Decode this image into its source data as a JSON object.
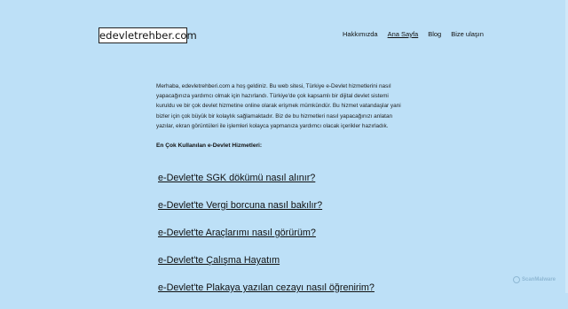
{
  "header": {
    "logo_text": "edevletrehber.com",
    "nav": [
      {
        "label": "Hakkımızda",
        "active": false
      },
      {
        "label": "Ana Sayfa",
        "active": true
      },
      {
        "label": "Blog",
        "active": false
      },
      {
        "label": "Bize ulaşın",
        "active": false
      }
    ]
  },
  "main": {
    "intro": "Merhaba, edevletrehberi.com a hoş geldiniz. Bu web sitesi, Türkiye e-Devlet hizmetlerini nasıl yapacağınıza yardımcı olmak için hazırlandı. Türkiye'de çok kapsamlı bir dijital devlet sistemi kuruldu ve bir çok devlet hizmetine online olarak erişmek mümkündür. Bu hizmet vatandaşlar yani bizler için çok büyük bir kolaylık sağlamaktadır. Biz de bu hizmetleri nasıl yapacağınızı anlatan yazılar, ekran görüntüleri ile işlemleri kolayca yapmanıza yardımcı olacak içerikler hazırladık.",
    "section_title": "En Çok Kullanılan e-Devlet Hizmetleri:",
    "services": [
      "e-Devlet'te SGK dökümü nasıl alınır?",
      "e-Devlet'te Vergi borcuna nasıl bakılır?",
      "e-Devlet'te Araçlarımı nasıl görürüm?",
      "e-Devlet'te Çalışma Hayatım",
      "e-Devlet'te Plakaya yazılan cezayı nasıl öğrenirim?"
    ]
  },
  "watermark": {
    "text": "ScanMalware"
  }
}
